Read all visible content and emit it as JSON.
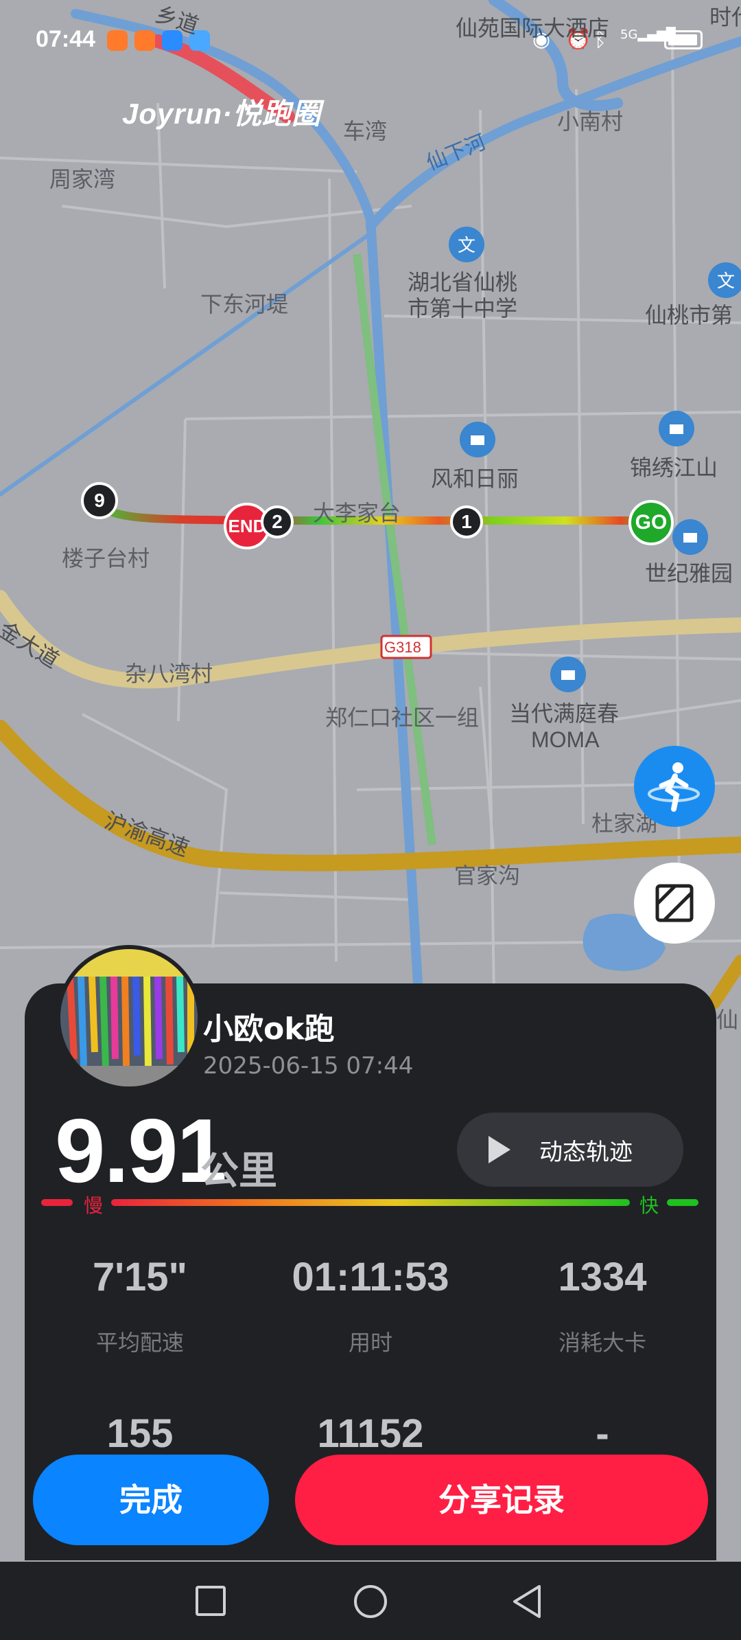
{
  "status_bar": {
    "time": "07:44",
    "app_icons": [
      "app-icon-a",
      "app-icon-b",
      "browser-icon",
      "weather-icon"
    ],
    "system_icons": [
      "eye-icon",
      "alarm-icon",
      "bluetooth-icon",
      "signal-5g-icon",
      "battery-icon"
    ],
    "network": "5G"
  },
  "brand": {
    "logo_text": "Joyrun·悦跑圈"
  },
  "map": {
    "labels": {
      "road_x2": "乡道",
      "hotel": "仙苑国际大酒店",
      "top_right": "时代",
      "chewan": "车湾",
      "xiaonan": "小南村",
      "zhoujiawan": "周家湾",
      "river_xianxia": "仙下河",
      "school_line1": "湖北省仙桃",
      "school_line2": "市第十中学",
      "xiandongdi": "下东河堤",
      "xiantao_city": "仙桃市第",
      "fengherili": "风和日丽",
      "jinxiu": "锦绣江山",
      "datu": "大李家台",
      "louzitai": "楼子台村",
      "shiji": "世纪雅园",
      "jin_avenue": "金大道",
      "zabawan": "杂八湾村",
      "g318": "G318",
      "zhengren": "郑仁口社区一组",
      "dangdai_line1": "当代满庭春",
      "dangdai_line2": "MOMA",
      "huyu": "沪渝高速",
      "dujiahu": "杜家湖",
      "guanjiagou": "官家沟",
      "xian_bottom": "仙"
    },
    "route_markers": {
      "start": "GO",
      "end": "END",
      "km1": "1",
      "km2": "2",
      "km9": "9"
    },
    "accent_colors": {
      "route_slow": "#e8243c",
      "route_mid": "#f0e020",
      "route_fast": "#20c020",
      "water": "#6f9fd4",
      "highway": "#c79a20"
    }
  },
  "side_buttons": {
    "runner_button_icon": "runner-icon",
    "map_style_button_icon": "map-layer-icon"
  },
  "record": {
    "username": "小欧ok跑",
    "datetime": "2025-06-15 07:44",
    "distance": "9.91",
    "distance_unit": "公里",
    "playback_label": "动态轨迹",
    "speed_slow_label": "慢",
    "speed_fast_label": "快",
    "stats": [
      {
        "value": "7'15\"",
        "label": "平均配速"
      },
      {
        "value": "01:11:53",
        "label": "用时"
      },
      {
        "value": "1334",
        "label": "消耗大卡"
      }
    ],
    "stats_row2": [
      {
        "value": "155"
      },
      {
        "value": "11152"
      },
      {
        "value": "-"
      }
    ]
  },
  "actions": {
    "done_label": "完成",
    "share_label": "分享记录",
    "done_color": "#0a84ff",
    "share_color": "#ff1f44"
  },
  "nav_bar": {
    "icons": [
      "recents-square-icon",
      "home-circle-icon",
      "back-triangle-icon"
    ]
  }
}
